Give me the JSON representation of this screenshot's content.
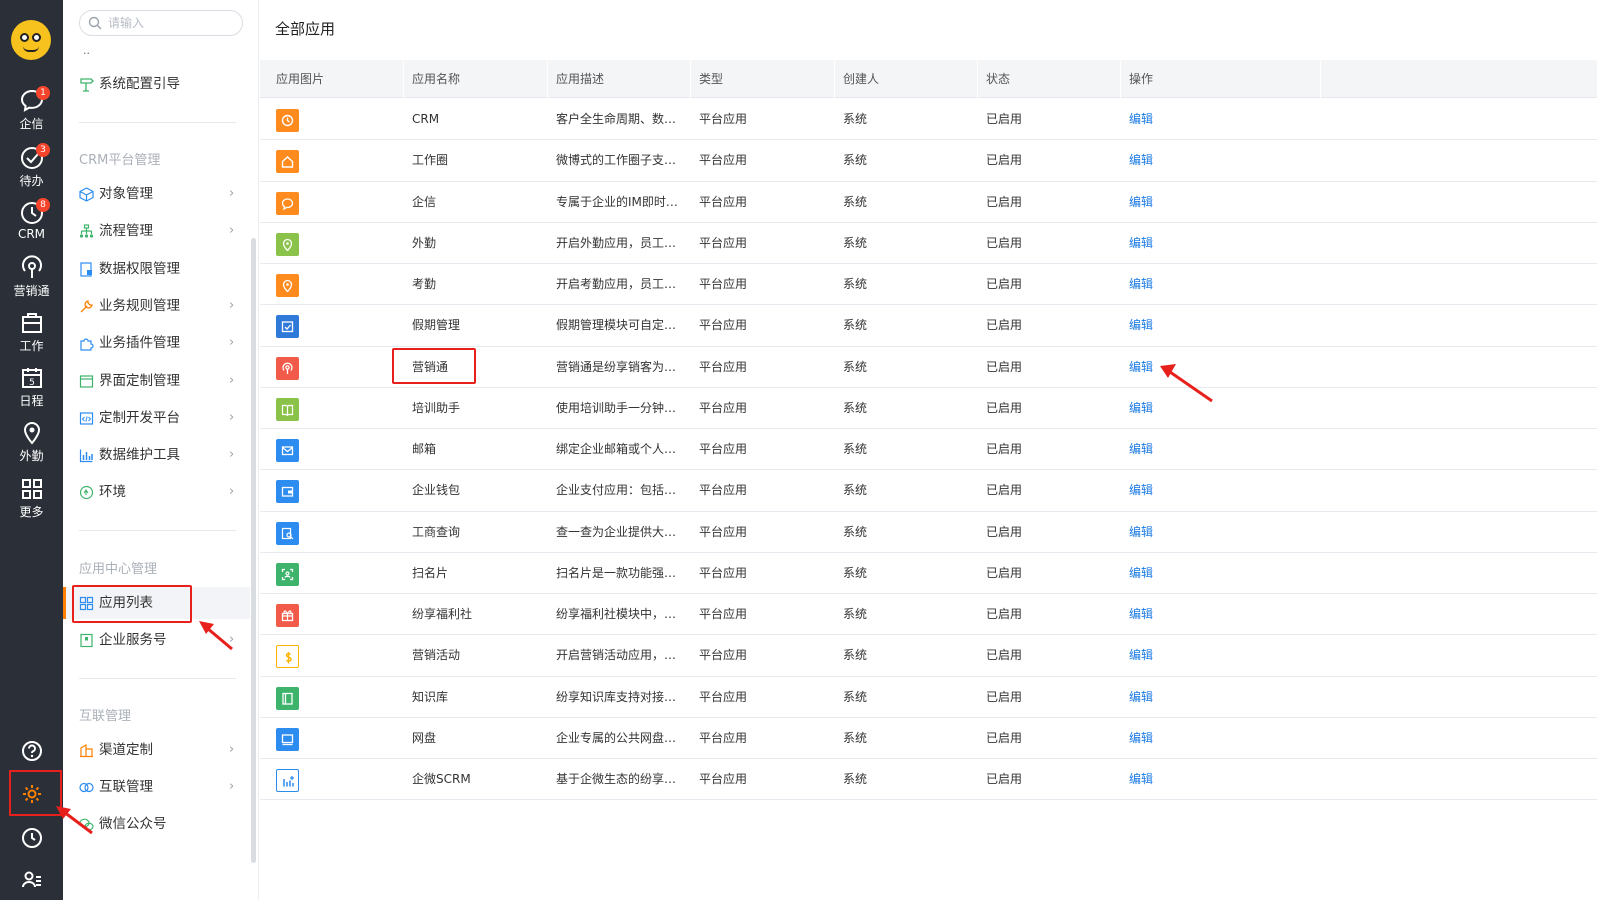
{
  "rail": {
    "items": [
      {
        "label": "企信",
        "badge": "1"
      },
      {
        "label": "待办",
        "badge": "3"
      },
      {
        "label": "CRM",
        "badge": "8"
      },
      {
        "label": "营销通",
        "badge": ""
      },
      {
        "label": "工作",
        "badge": ""
      },
      {
        "label": "日程",
        "badge": ""
      },
      {
        "label": "外勤",
        "badge": ""
      },
      {
        "label": "更多",
        "badge": ""
      }
    ],
    "calendar_day": "5"
  },
  "sidebar": {
    "search_placeholder": "请输入",
    "ellipsis": "..",
    "guide_label": "系统配置引导",
    "crm_title": "CRM平台管理",
    "crm_items": [
      {
        "label": "对象管理"
      },
      {
        "label": "流程管理"
      },
      {
        "label": "数据权限管理"
      },
      {
        "label": "业务规则管理"
      },
      {
        "label": "业务插件管理"
      },
      {
        "label": "界面定制管理"
      },
      {
        "label": "定制开发平台"
      },
      {
        "label": "数据维护工具"
      },
      {
        "label": "环境"
      }
    ],
    "app_center_title": "应用中心管理",
    "app_center_items": [
      {
        "label": "应用列表"
      },
      {
        "label": "企业服务号"
      }
    ],
    "interconnect_title": "互联管理",
    "interconnect_items": [
      {
        "label": "渠道定制"
      },
      {
        "label": "互联管理"
      },
      {
        "label": "微信公众号"
      }
    ]
  },
  "main": {
    "title": "全部应用",
    "columns": [
      "应用图片",
      "应用名称",
      "应用描述",
      "类型",
      "创建人",
      "状态",
      "操作"
    ],
    "rows": [
      {
        "icon": "clock-icon",
        "color": "#ff8a1e",
        "name": "CRM",
        "desc": "客户全生命周期、数…",
        "type": "平台应用",
        "creator": "系统",
        "status": "已启用",
        "action": "编辑"
      },
      {
        "icon": "home-icon",
        "color": "#ff8a1e",
        "name": "工作圈",
        "desc": "微博式的工作圈子支…",
        "type": "平台应用",
        "creator": "系统",
        "status": "已启用",
        "action": "编辑"
      },
      {
        "icon": "chat-icon",
        "color": "#ff8a1e",
        "name": "企信",
        "desc": "专属于企业的IM即时…",
        "type": "平台应用",
        "creator": "系统",
        "status": "已启用",
        "action": "编辑"
      },
      {
        "icon": "location-icon",
        "color": "#8bc34a",
        "name": "外勤",
        "desc": "开启外勤应用，员工…",
        "type": "平台应用",
        "creator": "系统",
        "status": "已启用",
        "action": "编辑"
      },
      {
        "icon": "location-icon",
        "color": "#ff8a1e",
        "name": "考勤",
        "desc": "开启考勤应用，员工…",
        "type": "平台应用",
        "creator": "系统",
        "status": "已启用",
        "action": "编辑"
      },
      {
        "icon": "check-icon",
        "color": "#2f7ad8",
        "name": "假期管理",
        "desc": "假期管理模块可自定…",
        "type": "平台应用",
        "creator": "系统",
        "status": "已启用",
        "action": "编辑"
      },
      {
        "icon": "broadcast-icon",
        "color": "#f25b4a",
        "name": "营销通",
        "desc": "营销通是纷享销客为…",
        "type": "平台应用",
        "creator": "系统",
        "status": "已启用",
        "action": "编辑"
      },
      {
        "icon": "book-icon",
        "color": "#8bc34a",
        "name": "培训助手",
        "desc": "使用培训助手一分钟…",
        "type": "平台应用",
        "creator": "系统",
        "status": "已启用",
        "action": "编辑"
      },
      {
        "icon": "mail-icon",
        "color": "#2d8cf0",
        "name": "邮箱",
        "desc": "绑定企业邮箱或个人…",
        "type": "平台应用",
        "creator": "系统",
        "status": "已启用",
        "action": "编辑"
      },
      {
        "icon": "wallet-icon",
        "color": "#2d8cf0",
        "name": "企业钱包",
        "desc": "企业支付应用：包括…",
        "type": "平台应用",
        "creator": "系统",
        "status": "已启用",
        "action": "编辑"
      },
      {
        "icon": "search-doc-icon",
        "color": "#2d8cf0",
        "name": "工商查询",
        "desc": "查一查为企业提供大…",
        "type": "平台应用",
        "creator": "系统",
        "status": "已启用",
        "action": "编辑"
      },
      {
        "icon": "scan-icon",
        "color": "#3db36b",
        "name": "扫名片",
        "desc": "扫名片是一款功能强…",
        "type": "平台应用",
        "creator": "系统",
        "status": "已启用",
        "action": "编辑"
      },
      {
        "icon": "gift-icon",
        "color": "#f25b4a",
        "name": "纷享福利社",
        "desc": "纷享福利社模块中，…",
        "type": "平台应用",
        "creator": "系统",
        "status": "已启用",
        "action": "编辑"
      },
      {
        "icon": "dollar-icon",
        "color": "#ffb400",
        "name": "营销活动",
        "desc": "开启营销活动应用，…",
        "type": "平台应用",
        "creator": "系统",
        "status": "已启用",
        "action": "编辑"
      },
      {
        "icon": "library-icon",
        "color": "#3db36b",
        "name": "知识库",
        "desc": "纷享知识库支持对接…",
        "type": "平台应用",
        "creator": "系统",
        "status": "已启用",
        "action": "编辑"
      },
      {
        "icon": "disk-icon",
        "color": "#2d8cf0",
        "name": "网盘",
        "desc": "企业专属的公共网盘…",
        "type": "平台应用",
        "creator": "系统",
        "status": "已启用",
        "action": "编辑"
      },
      {
        "icon": "chart-plus-icon",
        "color": "#2d8cf0",
        "name": "企微SCRM",
        "desc": "基于企微生态的纷享S…",
        "type": "平台应用",
        "creator": "系统",
        "status": "已启用",
        "action": "编辑"
      }
    ]
  }
}
